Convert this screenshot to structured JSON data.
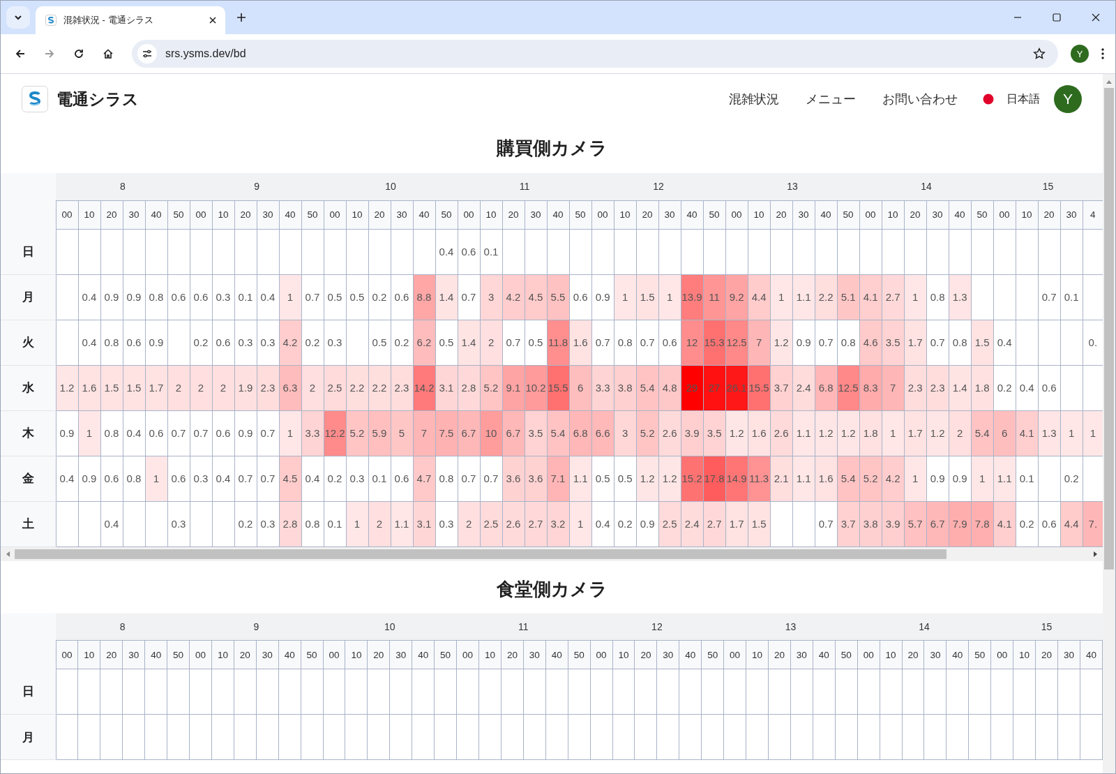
{
  "browser": {
    "tab_title": "混雑状況 - 電通シラス",
    "url": "srs.ysms.dev/bd",
    "profile_initial": "Y"
  },
  "site_header": {
    "brand": "電通シラス",
    "nav": [
      "混雑状況",
      "メニュー",
      "お問い合わせ"
    ],
    "language": "日本語",
    "avatar_initial": "Y"
  },
  "sections": [
    {
      "title": "購買側カメラ",
      "hours": [
        "8",
        "9",
        "10",
        "11",
        "12",
        "13",
        "14",
        "15"
      ],
      "minutes": [
        "00",
        "10",
        "20",
        "30",
        "40",
        "50",
        "00",
        "10",
        "20",
        "30",
        "40",
        "50",
        "00",
        "10",
        "20",
        "30",
        "40",
        "50",
        "00",
        "10",
        "20",
        "30",
        "40",
        "50",
        "00",
        "10",
        "20",
        "30",
        "40",
        "50",
        "00",
        "10",
        "20",
        "30",
        "40",
        "50",
        "00",
        "10",
        "20",
        "30",
        "40",
        "50",
        "00",
        "10",
        "20",
        "30",
        "4"
      ],
      "rows": [
        {
          "day": "日",
          "cells": [
            null,
            null,
            null,
            null,
            null,
            null,
            null,
            null,
            null,
            null,
            null,
            null,
            null,
            null,
            null,
            null,
            null,
            "0.4",
            "0.6",
            "0.1",
            null,
            null,
            null,
            null,
            null,
            null,
            null,
            null,
            null,
            null,
            null,
            null,
            null,
            null,
            null,
            null,
            null,
            null,
            null,
            null,
            null,
            null,
            null,
            null,
            null,
            null,
            null
          ]
        },
        {
          "day": "月",
          "cells": [
            null,
            "0.4",
            "0.9",
            "0.9",
            "0.8",
            "0.6",
            "0.6",
            "0.3",
            "0.1",
            "0.4",
            "1",
            "0.7",
            "0.5",
            "0.5",
            "0.2",
            "0.6",
            "8.8",
            "1.4",
            "0.7",
            "3",
            "4.2",
            "4.5",
            "5.5",
            "0.6",
            "0.9",
            "1",
            "1.5",
            "1",
            "13.9",
            "11",
            "9.2",
            "4.4",
            "1",
            "1.1",
            "2.2",
            "5.1",
            "4.1",
            "2.7",
            "1",
            "0.8",
            "1.3",
            null,
            null,
            null,
            "0.7",
            "0.1",
            null
          ]
        },
        {
          "day": "火",
          "cells": [
            null,
            "0.4",
            "0.8",
            "0.6",
            "0.9",
            null,
            "0.2",
            "0.6",
            "0.3",
            "0.3",
            "4.2",
            "0.2",
            "0.3",
            null,
            "0.5",
            "0.2",
            "6.2",
            "0.5",
            "1.4",
            "2",
            "0.7",
            "0.5",
            "11.8",
            "1.6",
            "0.7",
            "0.8",
            "0.7",
            "0.6",
            "12",
            "15.3",
            "12.5",
            "7",
            "1.2",
            "0.9",
            "0.7",
            "0.8",
            "4.6",
            "3.5",
            "1.7",
            "0.7",
            "0.8",
            "1.5",
            "0.4",
            null,
            null,
            null,
            "0."
          ]
        },
        {
          "day": "水",
          "cells": [
            "1.2",
            "1.6",
            "1.5",
            "1.5",
            "1.7",
            "2",
            "2",
            "2",
            "1.9",
            "2.3",
            "6.3",
            "2",
            "2.5",
            "2.2",
            "2.2",
            "2.3",
            "14.2",
            "3.1",
            "2.8",
            "5.2",
            "9.1",
            "10.2",
            "15.5",
            "6",
            "3.3",
            "3.8",
            "5.4",
            "4.8",
            "29",
            "27",
            "26.1",
            "15.5",
            "3.7",
            "2.4",
            "6.8",
            "12.5",
            "8.3",
            "7",
            "2.3",
            "2.3",
            "1.4",
            "1.8",
            "0.2",
            "0.4",
            "0.6",
            null,
            null
          ]
        },
        {
          "day": "木",
          "cells": [
            "0.9",
            "1",
            "0.8",
            "0.4",
            "0.6",
            "0.7",
            "0.7",
            "0.6",
            "0.9",
            "0.7",
            "1",
            "3.3",
            "12.2",
            "5.2",
            "5.9",
            "5",
            "7",
            "7.5",
            "6.7",
            "10",
            "6.7",
            "3.5",
            "5.4",
            "6.8",
            "6.6",
            "3",
            "5.2",
            "2.6",
            "3.9",
            "3.5",
            "1.2",
            "1.6",
            "2.6",
            "1.1",
            "1.2",
            "1.2",
            "1.8",
            "1",
            "1.7",
            "1.2",
            "2",
            "5.4",
            "6",
            "4.1",
            "1.3",
            "1",
            "1"
          ]
        },
        {
          "day": "金",
          "cells": [
            "0.4",
            "0.9",
            "0.6",
            "0.8",
            "1",
            "0.6",
            "0.3",
            "0.4",
            "0.7",
            "0.7",
            "4.5",
            "0.4",
            "0.2",
            "0.3",
            "0.1",
            "0.6",
            "4.7",
            "0.8",
            "0.7",
            "0.7",
            "3.6",
            "3.6",
            "7.1",
            "1.1",
            "0.5",
            "0.5",
            "1.2",
            "1.2",
            "15.2",
            "17.8",
            "14.9",
            "11.3",
            "2.1",
            "1.1",
            "1.6",
            "5.4",
            "5.2",
            "4.2",
            "1",
            "0.9",
            "0.9",
            "1",
            "1.1",
            "0.1",
            null,
            "0.2",
            null
          ]
        },
        {
          "day": "土",
          "cells": [
            null,
            null,
            "0.4",
            null,
            null,
            "0.3",
            null,
            null,
            "0.2",
            "0.3",
            "2.8",
            "0.8",
            "0.1",
            "1",
            "2",
            "1.1",
            "3.1",
            "0.3",
            "2",
            "2.5",
            "2.6",
            "2.7",
            "3.2",
            "1",
            "0.4",
            "0.2",
            "0.9",
            "2.5",
            "2.4",
            "2.7",
            "1.7",
            "1.5",
            null,
            null,
            "0.7",
            "3.7",
            "3.8",
            "3.9",
            "5.7",
            "6.7",
            "7.9",
            "7.8",
            "4.1",
            "0.2",
            "0.6",
            "4.4",
            "7."
          ]
        }
      ]
    },
    {
      "title": "食堂側カメラ",
      "hours": [
        "8",
        "9",
        "10",
        "11",
        "12",
        "13",
        "14",
        "15"
      ],
      "minutes": [
        "00",
        "10",
        "20",
        "30",
        "40",
        "50",
        "00",
        "10",
        "20",
        "30",
        "40",
        "50",
        "00",
        "10",
        "20",
        "30",
        "40",
        "50",
        "00",
        "10",
        "20",
        "30",
        "40",
        "50",
        "00",
        "10",
        "20",
        "30",
        "40",
        "50",
        "00",
        "10",
        "20",
        "30",
        "40",
        "50",
        "00",
        "10",
        "20",
        "30",
        "40",
        "50",
        "00",
        "10",
        "20",
        "30",
        "40"
      ],
      "rows": [
        {
          "day": "日"
        },
        {
          "day": "月"
        }
      ]
    }
  ]
}
